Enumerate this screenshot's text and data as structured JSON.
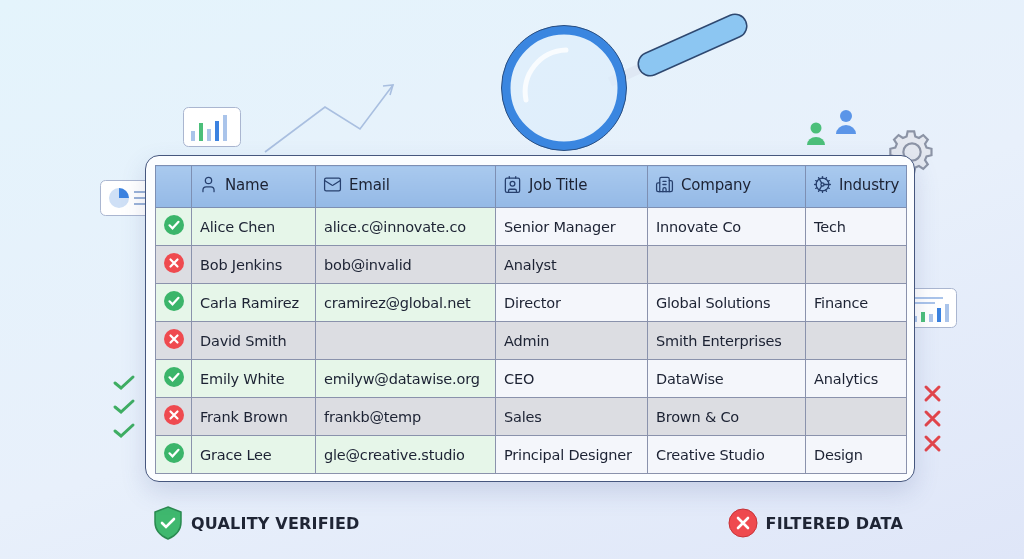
{
  "table": {
    "columns": [
      "Name",
      "Email",
      "Job Title",
      "Company",
      "Industry"
    ],
    "rows": [
      {
        "valid": true,
        "cells": [
          "Alice Chen",
          "alice.c@innovate.co",
          "Senior Manager",
          "Innovate Co",
          "Tech"
        ]
      },
      {
        "valid": false,
        "cells": [
          "Bob Jenkins",
          "bob@invalid",
          "Analyst",
          "",
          ""
        ]
      },
      {
        "valid": true,
        "cells": [
          "Carla Ramirez",
          "cramirez@global.net",
          "Director",
          "Global Solutions",
          "Finance"
        ]
      },
      {
        "valid": false,
        "cells": [
          "David Smith",
          "",
          "Admin",
          "Smith Enterprises",
          ""
        ]
      },
      {
        "valid": true,
        "cells": [
          "Emily White",
          "emilyw@datawise.org",
          "CEO",
          "DataWise",
          "Analytics"
        ]
      },
      {
        "valid": false,
        "cells": [
          "Frank Brown",
          "frankb@temp",
          "Sales",
          "Brown & Co",
          ""
        ]
      },
      {
        "valid": true,
        "cells": [
          "Grace Lee",
          "gle@creative.studio",
          "Principal Designer",
          "Creative Studio",
          "Design"
        ]
      }
    ]
  },
  "legend": [
    {
      "kind": "verified",
      "label": "QUALITY VERIFIED"
    },
    {
      "kind": "filtered",
      "label": "FILTERED DATA"
    }
  ]
}
